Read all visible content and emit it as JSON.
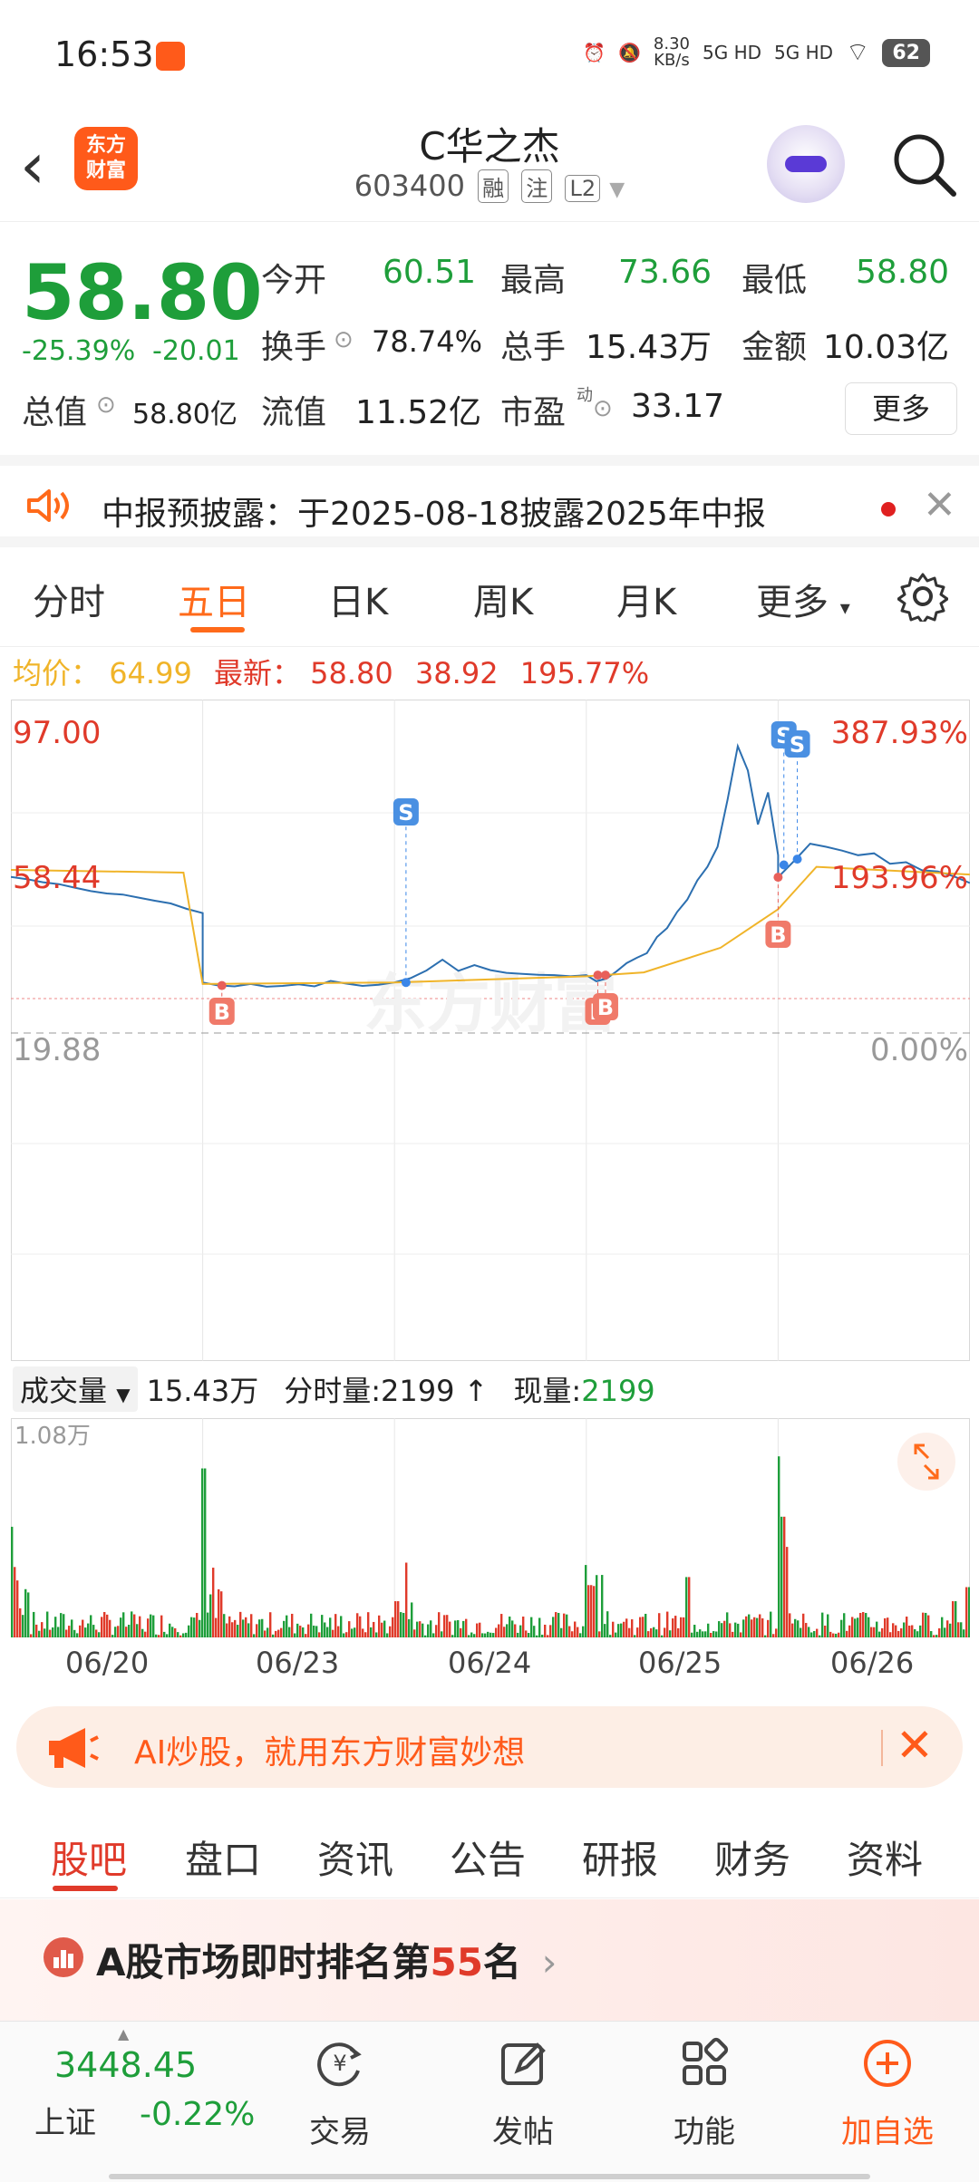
{
  "status_bar": {
    "time": "16:53",
    "net_speed": "8.30",
    "net_unit": "KB/s",
    "sig1": "5G HD",
    "sig2": "5G HD",
    "battery": "62"
  },
  "header": {
    "logo_line1": "东方",
    "logo_line2": "财富",
    "stock_name": "C华之杰",
    "stock_code": "603400",
    "tags": [
      "融",
      "注",
      "L2"
    ]
  },
  "quote": {
    "price": "58.80",
    "change_pct": "-25.39%",
    "change_amt": "-20.01",
    "open_label": "今开",
    "open": "60.51",
    "high_label": "最高",
    "high": "73.66",
    "low_label": "最低",
    "low": "58.80",
    "turnover_label": "换手",
    "turnover": "78.74%",
    "volume_label": "总手",
    "volume": "15.43万",
    "amount_label": "金额",
    "amount": "10.03亿",
    "mktcap_label": "总值",
    "mktcap": "58.80亿",
    "float_label": "流值",
    "float": "11.52亿",
    "pe_label": "市盈",
    "pe_sup": "动",
    "pe": "33.17",
    "more": "更多"
  },
  "notice": {
    "text": "中报预披露：于2025-08-18披露2025年中报"
  },
  "period_tabs": [
    "分时",
    "五日",
    "日K",
    "周K",
    "月K",
    "更多"
  ],
  "avg": {
    "avg_label": "均价：",
    "avg_value": "64.99",
    "latest_label": "最新：",
    "latest_value": "58.80",
    "change": "38.92",
    "change_pct": "195.77%"
  },
  "chart_data": {
    "type": "line",
    "y_labels_left": [
      "97.00",
      "58.44",
      "19.88"
    ],
    "y_labels_right": [
      "387.93%",
      "193.96%",
      "0.00%"
    ],
    "ylim": [
      19.88,
      97.0
    ],
    "watermark": "东方财富",
    "x_dates": [
      "06/20",
      "06/23",
      "06/24",
      "06/25",
      "06/26"
    ],
    "markers": [
      {
        "label": "B",
        "day": 1,
        "price": 32.2
      },
      {
        "label": "S",
        "day": 2,
        "price": 33.0
      },
      {
        "label": "B",
        "day": 3,
        "price": 34.9
      },
      {
        "label": "B",
        "day": 3,
        "price": 34.9
      },
      {
        "label": "S",
        "day": 4,
        "price": 63.5
      },
      {
        "label": "S",
        "day": 4,
        "price": 65.0
      },
      {
        "label": "B",
        "day": 4,
        "price": 60.3
      }
    ]
  },
  "volume": {
    "selector": "成交量",
    "total": "15.43万",
    "tick_label": "分时量:",
    "tick_value": "2199",
    "now_label": "现量:",
    "now_value": "2199",
    "axis_max": "1.08万"
  },
  "ai_banner": {
    "text": "AI炒股，就用东方财富妙想"
  },
  "section_tabs": [
    "股吧",
    "盘口",
    "资讯",
    "公告",
    "研报",
    "财务",
    "资料"
  ],
  "rank": {
    "prefix": "A股市场即时排名第",
    "number": "55",
    "suffix": "名"
  },
  "bottom": {
    "index_value": "3448.45",
    "index_name": "上证",
    "index_change": "-0.22%",
    "nav": [
      {
        "label": "交易",
        "icon": "yuan-exchange-icon"
      },
      {
        "label": "发帖",
        "icon": "compose-icon"
      },
      {
        "label": "功能",
        "icon": "grid-icon"
      },
      {
        "label": "加自选",
        "icon": "add-favorite-icon"
      }
    ]
  },
  "colors": {
    "accent": "#ff6a1a",
    "up": "#e03a2a",
    "down": "#1e9e3a",
    "price_line": "#2c6fb0",
    "avg_line": "#f0b429"
  }
}
